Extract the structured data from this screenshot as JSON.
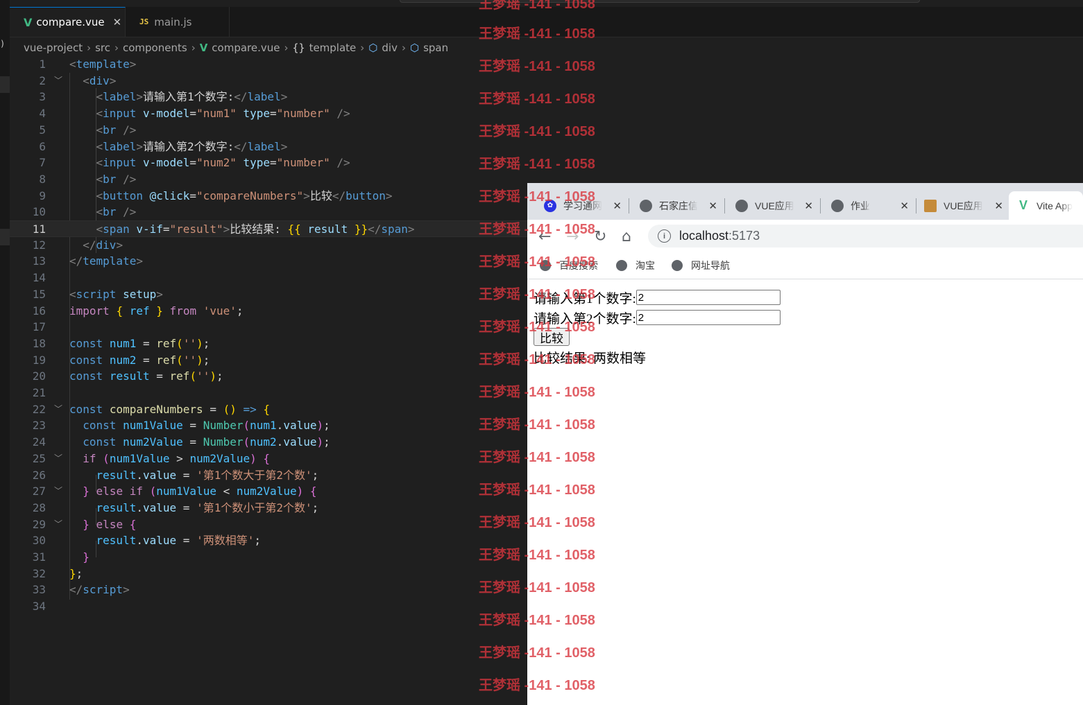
{
  "editor": {
    "tabs": [
      {
        "label": "compare.vue",
        "icon": "vue-icon",
        "active": true
      },
      {
        "label": "main.js",
        "icon": "js-icon",
        "active": false
      }
    ],
    "breadcrumbs": [
      "vue-project",
      "src",
      "components",
      "compare.vue",
      "template",
      "div",
      "span"
    ],
    "current_line": 11
  },
  "browser": {
    "tabs": [
      {
        "title": "学习通网",
        "icon": "baidu-paw-icon"
      },
      {
        "title": "石家庄信",
        "icon": "globe-icon"
      },
      {
        "title": "VUE应用",
        "icon": "globe-icon"
      },
      {
        "title": "作业",
        "icon": "globe-icon"
      },
      {
        "title": "VUE应用",
        "icon": "image-icon"
      },
      {
        "title": "Vite App",
        "icon": "vite-icon",
        "active": true
      }
    ],
    "address": {
      "host": "localhost",
      "port": ":5173"
    },
    "bookmarks": [
      "百度搜索",
      "淘宝",
      "网址导航"
    ],
    "page": {
      "label1": "请输入第1个数字:",
      "input1_value": "2",
      "label2": "请输入第2个数字:",
      "input2_value": "2",
      "button_label": "比较",
      "result_text": "比较结果: 两数相等"
    }
  },
  "watermark": {
    "text": "王梦瑶 -141 - 1058",
    "color": "#d9363e"
  },
  "colors": {
    "editor_bg": "#1f1f1f",
    "tabbar_bg": "#181818",
    "tab_active_border": "#0078d4",
    "browser_tabstrip": "#dee1e6",
    "vue_green": "#41b883"
  }
}
